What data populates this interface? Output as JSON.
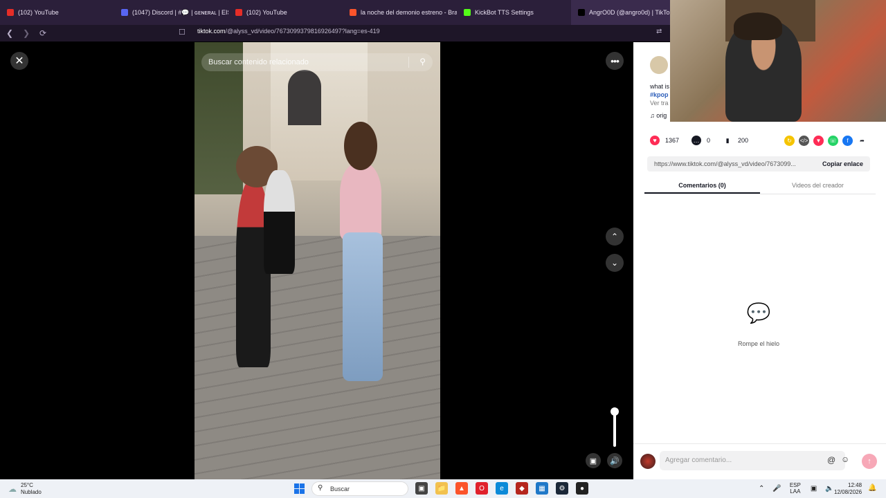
{
  "browser": {
    "tabs": [
      {
        "label": "(102) YouTube",
        "color": "#e52d27"
      },
      {
        "label": "(1047) Discord | #💬 | ɢᴇɴᴇʀᴀʟ | EIS",
        "color": "#5865f2"
      },
      {
        "label": "(102) YouTube",
        "color": "#e52d27"
      },
      {
        "label": "la noche del demonio estreno - Brav",
        "color": "#fb542b"
      },
      {
        "label": "KickBot TTS Settings",
        "color": "#53fc18"
      },
      {
        "label": "AngrO0D (@angro0d) | TikTo",
        "color": "#000000"
      }
    ],
    "url_host": "tiktok.com",
    "url_path": "/@alyss_vd/video/7673099379816926497?lang=es-419"
  },
  "video": {
    "search_placeholder": "Buscar contenido relacionado"
  },
  "panel": {
    "desc_line1": "what is",
    "desc_tag": "#kpop",
    "desc_translate": "Ver tra",
    "desc_sound": "♫ orig",
    "likes": "1367",
    "comments": "0",
    "saves": "200",
    "link": "https://www.tiktok.com/@alyss_vd/video/7673099...",
    "copy_label": "Copiar enlace",
    "tab_comments": "Comentarios (0)",
    "tab_creator": "Videos del creador",
    "empty_text": "Rompe el hielo",
    "comment_placeholder": "Agregar comentario..."
  },
  "taskbar": {
    "temp": "25°C",
    "weather": "Nublado",
    "search": "Buscar",
    "lang1": "ESP",
    "lang2": "LAA",
    "time": "12:48",
    "date": "12/08/2026"
  }
}
